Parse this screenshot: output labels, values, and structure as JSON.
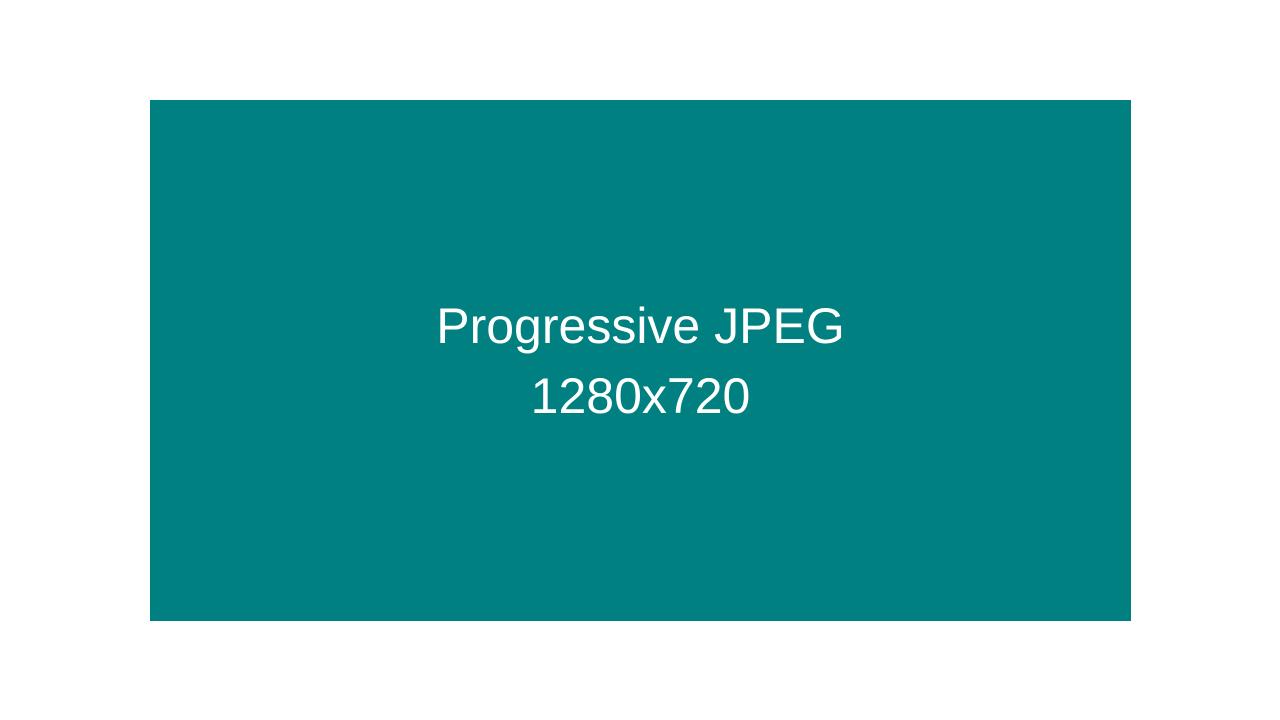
{
  "panel": {
    "background_color": "#008080",
    "text_color": "#ffffff",
    "line1": "Progressive JPEG",
    "line2": "1280x720"
  },
  "page": {
    "background_color": "#ffffff"
  }
}
